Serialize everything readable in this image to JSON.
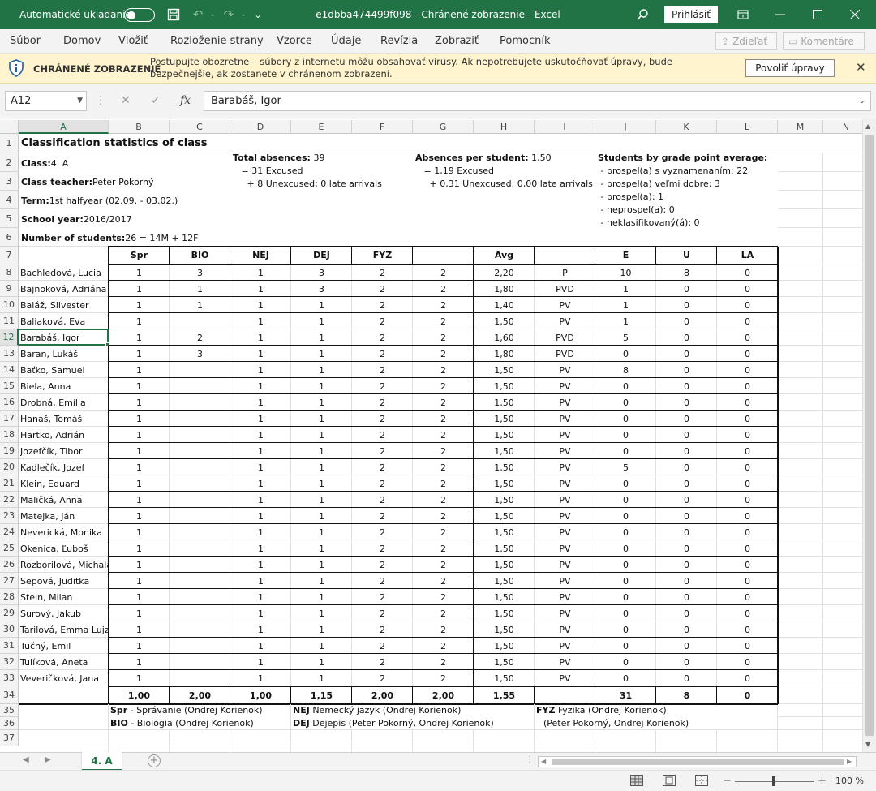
{
  "titlebar": {
    "autosave_label": "Automatické ukladanie",
    "title": "e1dbba474499f098  -  Chránené zobrazenie  -  Excel",
    "signin_label": "Prihlásiť",
    "accent": "#217346"
  },
  "ribbon": {
    "tabs": [
      "Súbor",
      "Domov",
      "Vložiť",
      "Rozloženie strany",
      "Vzorce",
      "Údaje",
      "Revízia",
      "Zobraziť",
      "Pomocník"
    ],
    "share_label": "Zdieľať",
    "comments_label": "Komentáre"
  },
  "protected_view": {
    "title": "CHRÁNENÉ ZOBRAZENIE",
    "message": "Postupujte obozretne – súbory z internetu môžu obsahovať vírusy. Ak nepotrebujete uskutočňovať úpravy, bude bezpečnejšie, ak zostanete v chránenom zobrazení.",
    "enable_button": "Povoliť úpravy",
    "bar_color": "#fff4ce"
  },
  "formula_bar": {
    "name_box": "A12",
    "fx_label": "fx",
    "value": "Barabáš, Igor"
  },
  "grid": {
    "columns": [
      "A",
      "B",
      "C",
      "D",
      "E",
      "F",
      "G",
      "H",
      "I",
      "J",
      "K",
      "L",
      "M",
      "N"
    ],
    "rows": [
      "1",
      "2",
      "3",
      "4",
      "5",
      "6",
      "7",
      "8",
      "9",
      "10",
      "11",
      "12",
      "13",
      "14",
      "15",
      "16",
      "17",
      "18",
      "19",
      "20",
      "21",
      "22",
      "23",
      "24",
      "25",
      "26",
      "27",
      "28",
      "29",
      "30",
      "31",
      "32",
      "33",
      "34",
      "35",
      "36",
      "37"
    ],
    "selected_column": "A",
    "selected_row": "12"
  },
  "sheet": {
    "title": "Classification statistics of class",
    "info_left": [
      {
        "label": "Class:",
        "value": "4. A"
      },
      {
        "label": "Class teacher:",
        "value": "Peter Pokorný"
      },
      {
        "label": "Term:",
        "value": "1st halfyear (02.09. - 03.02.)"
      },
      {
        "label": "School year:",
        "value": "2016/2017"
      },
      {
        "label": "Number of students:",
        "value": "26 = 14M + 12F"
      }
    ],
    "total_absences": {
      "label": "Total absences:",
      "value": "39",
      "line1": "= 31 Excused",
      "line2": "+ 8 Unexcused; 0 late arrivals"
    },
    "absences_per_student": {
      "label": "Absences per student:",
      "value": "1,50",
      "line1": "= 1,19 Excused",
      "line2": "+ 0,31 Unexcused; 0,00 late arrivals"
    },
    "grade_point": {
      "label": "Students by grade point average:",
      "lines": [
        "- prospel(a) s vyznamenaním: 22",
        "- prospel(a) veľmi dobre: 3",
        "- prospel(a): 1",
        "- neprospel(a): 0",
        "- neklasifikovaný(á): 0"
      ]
    },
    "headers": [
      "Spr",
      "BIO",
      "NEJ",
      "DEJ",
      "FYZ",
      "",
      "Avg",
      "",
      "E",
      "U",
      "LA"
    ],
    "students": [
      [
        "Bachledová, Lucia",
        "1",
        "3",
        "1",
        "3",
        "2",
        "2",
        "2,20",
        "P",
        "10",
        "8",
        "0"
      ],
      [
        "Bajnoková, Adriána",
        "1",
        "1",
        "1",
        "3",
        "2",
        "2",
        "1,80",
        "PVD",
        "1",
        "0",
        "0"
      ],
      [
        "Baláž, Silvester",
        "1",
        "1",
        "1",
        "1",
        "2",
        "2",
        "1,40",
        "PV",
        "1",
        "0",
        "0"
      ],
      [
        "Baliaková, Eva",
        "1",
        "",
        "1",
        "1",
        "2",
        "2",
        "1,50",
        "PV",
        "1",
        "0",
        "0"
      ],
      [
        "Barabáš, Igor",
        "1",
        "2",
        "1",
        "1",
        "2",
        "2",
        "1,60",
        "PVD",
        "5",
        "0",
        "0"
      ],
      [
        "Baran, Lukáš",
        "1",
        "3",
        "1",
        "1",
        "2",
        "2",
        "1,80",
        "PVD",
        "0",
        "0",
        "0"
      ],
      [
        "Baťko, Samuel",
        "1",
        "",
        "1",
        "1",
        "2",
        "2",
        "1,50",
        "PV",
        "8",
        "0",
        "0"
      ],
      [
        "Biela, Anna",
        "1",
        "",
        "1",
        "1",
        "2",
        "2",
        "1,50",
        "PV",
        "0",
        "0",
        "0"
      ],
      [
        "Drobná, Emília",
        "1",
        "",
        "1",
        "1",
        "2",
        "2",
        "1,50",
        "PV",
        "0",
        "0",
        "0"
      ],
      [
        "Hanaš, Tomáš",
        "1",
        "",
        "1",
        "1",
        "2",
        "2",
        "1,50",
        "PV",
        "0",
        "0",
        "0"
      ],
      [
        "Hartko, Adrián",
        "1",
        "",
        "1",
        "1",
        "2",
        "2",
        "1,50",
        "PV",
        "0",
        "0",
        "0"
      ],
      [
        "Jozefčík, Tibor",
        "1",
        "",
        "1",
        "1",
        "2",
        "2",
        "1,50",
        "PV",
        "0",
        "0",
        "0"
      ],
      [
        "Kadlečík, Jozef",
        "1",
        "",
        "1",
        "1",
        "2",
        "2",
        "1,50",
        "PV",
        "5",
        "0",
        "0"
      ],
      [
        "Klein, Eduard",
        "1",
        "",
        "1",
        "1",
        "2",
        "2",
        "1,50",
        "PV",
        "0",
        "0",
        "0"
      ],
      [
        "Maličká, Anna",
        "1",
        "",
        "1",
        "1",
        "2",
        "2",
        "1,50",
        "PV",
        "0",
        "0",
        "0"
      ],
      [
        "Matejka, Ján",
        "1",
        "",
        "1",
        "1",
        "2",
        "2",
        "1,50",
        "PV",
        "0",
        "0",
        "0"
      ],
      [
        "Neverická, Monika",
        "1",
        "",
        "1",
        "1",
        "2",
        "2",
        "1,50",
        "PV",
        "0",
        "0",
        "0"
      ],
      [
        "Okenica, Ľuboš",
        "1",
        "",
        "1",
        "1",
        "2",
        "2",
        "1,50",
        "PV",
        "0",
        "0",
        "0"
      ],
      [
        "Rozborilová, Michala",
        "1",
        "",
        "1",
        "1",
        "2",
        "2",
        "1,50",
        "PV",
        "0",
        "0",
        "0"
      ],
      [
        "Sepová, Juditka",
        "1",
        "",
        "1",
        "1",
        "2",
        "2",
        "1,50",
        "PV",
        "0",
        "0",
        "0"
      ],
      [
        "Stein, Milan",
        "1",
        "",
        "1",
        "1",
        "2",
        "2",
        "1,50",
        "PV",
        "0",
        "0",
        "0"
      ],
      [
        "Surový, Jakub",
        "1",
        "",
        "1",
        "1",
        "2",
        "2",
        "1,50",
        "PV",
        "0",
        "0",
        "0"
      ],
      [
        "Tarilová, Emma Lujza",
        "1",
        "",
        "1",
        "1",
        "2",
        "2",
        "1,50",
        "PV",
        "0",
        "0",
        "0"
      ],
      [
        "Tučný, Emil",
        "1",
        "",
        "1",
        "1",
        "2",
        "2",
        "1,50",
        "PV",
        "0",
        "0",
        "0"
      ],
      [
        "Tulíková, Aneta",
        "1",
        "",
        "1",
        "1",
        "2",
        "2",
        "1,50",
        "PV",
        "0",
        "0",
        "0"
      ],
      [
        "Veveričková, Jana",
        "1",
        "",
        "1",
        "1",
        "2",
        "2",
        "1,50",
        "PV",
        "0",
        "0",
        "0"
      ]
    ],
    "totals": [
      "",
      "1,00",
      "2,00",
      "1,00",
      "1,15",
      "2,00",
      "2,00",
      "1,55",
      "",
      "31",
      "8",
      "0"
    ],
    "legend": [
      {
        "abbr": "Spr",
        "text": "- Správanie (Ondrej Korienok)"
      },
      {
        "abbr": "BIO",
        "text": "- Biológia (Ondrej Korienok)"
      },
      {
        "abbr": "NEJ",
        "text": "Nemecký jazyk (Ondrej Korienok)"
      },
      {
        "abbr": "DEJ",
        "text": "Dejepis (Peter Pokorný, Ondrej Korienok)"
      },
      {
        "abbr": "FYZ",
        "text": "Fyzika (Ondrej Korienok)"
      },
      {
        "abbr": "",
        "text": "(Peter Pokorný, Ondrej Korienok)"
      }
    ]
  },
  "tabs_bar": {
    "sheet_tab": "4. A"
  },
  "status_bar": {
    "zoom": "100 %"
  }
}
